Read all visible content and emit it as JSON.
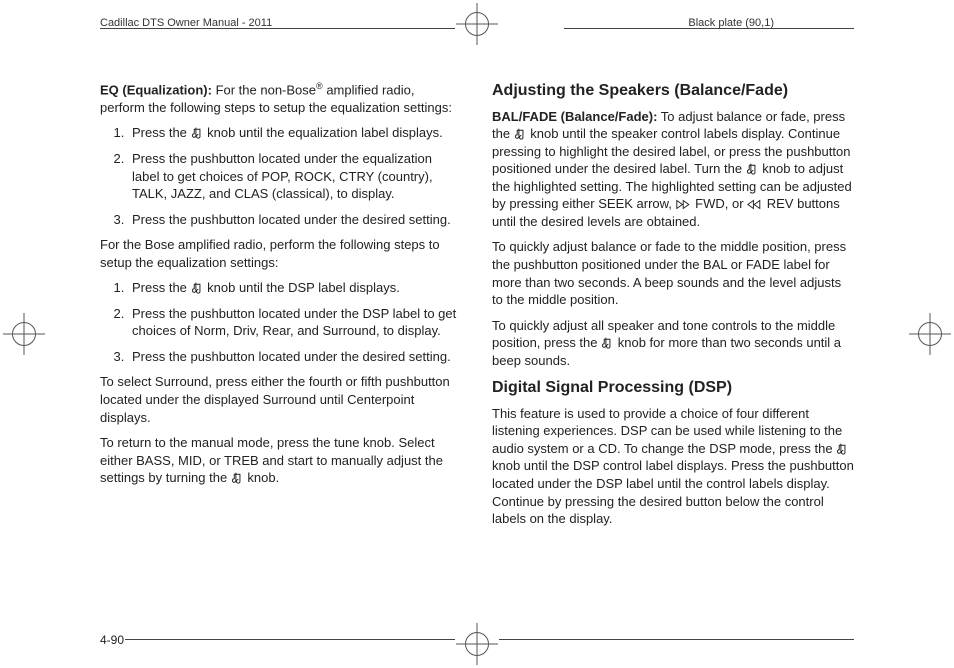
{
  "header": {
    "left": "Cadillac DTS Owner Manual - 2011",
    "right": "Black plate (90,1)"
  },
  "left_column": {
    "eq_label": "EQ (Equalization):",
    "eq_intro_pre": " For the non-Bose",
    "eq_intro_post": " amplified radio, perform the following steps to setup the equalization settings:",
    "eq_steps": [
      "Press the [TUNE] knob until the equalization label displays.",
      "Press the pushbutton located under the equalization label to get choices of POP, ROCK, CTRY (country), TALK, JAZZ, and CLAS (classical), to display.",
      "Press the pushbutton located under the desired setting."
    ],
    "bose_intro": "For the Bose amplified radio, perform the following steps to setup the equalization settings:",
    "bose_steps": [
      "Press the [TUNE] knob until the DSP label displays.",
      "Press the pushbutton located under the DSP label to get choices of Norm, Driv, Rear, and Surround, to display.",
      "Press the pushbutton located under the desired setting."
    ],
    "bose_surround_note": "To select Surround, press either the fourth or fifth pushbutton located under the displayed Surround until Centerpoint displays.",
    "manual_return": "To return to the manual mode, press the tune knob. Select either BASS, MID, or TREB and start to manually adjust the settings by turning the [TUNE] knob."
  },
  "right_column": {
    "speakers_heading": "Adjusting the Speakers (Balance/Fade)",
    "balfade_label": "BAL/FADE (Balance/Fade):",
    "balfade_body": " To adjust balance or fade, press the [TUNE] knob until the speaker control labels display. Continue pressing to highlight the desired label, or press the pushbutton positioned under the desired label. Turn the [TUNE] knob to adjust the highlighted setting. The highlighted setting can be adjusted by pressing either SEEK arrow, [FWD] FWD, or [REV] REV buttons until the desired levels are obtained.",
    "quick_balance": "To quickly adjust balance or fade to the middle position, press the pushbutton positioned under the BAL or FADE label for more than two seconds. A beep sounds and the level adjusts to the middle position.",
    "quick_all": "To quickly adjust all speaker and tone controls to the middle position, press the [TUNE] knob for more than two seconds until a beep sounds.",
    "dsp_heading": "Digital Signal Processing (DSP)",
    "dsp_body": "This feature is used to provide a choice of four different listening experiences. DSP can be used while listening to the audio system or a CD. To change the DSP mode, press the [TUNE] knob until the DSP control label displays. Press the pushbutton located under the DSP label until the control labels display. Continue by pressing the desired button below the control labels on the display."
  },
  "footer": {
    "page_number": "4-90"
  },
  "icons": {
    "tune": "♪",
    "fwd": "▷▷",
    "rev": "◁◁",
    "reg_sup": "®"
  }
}
